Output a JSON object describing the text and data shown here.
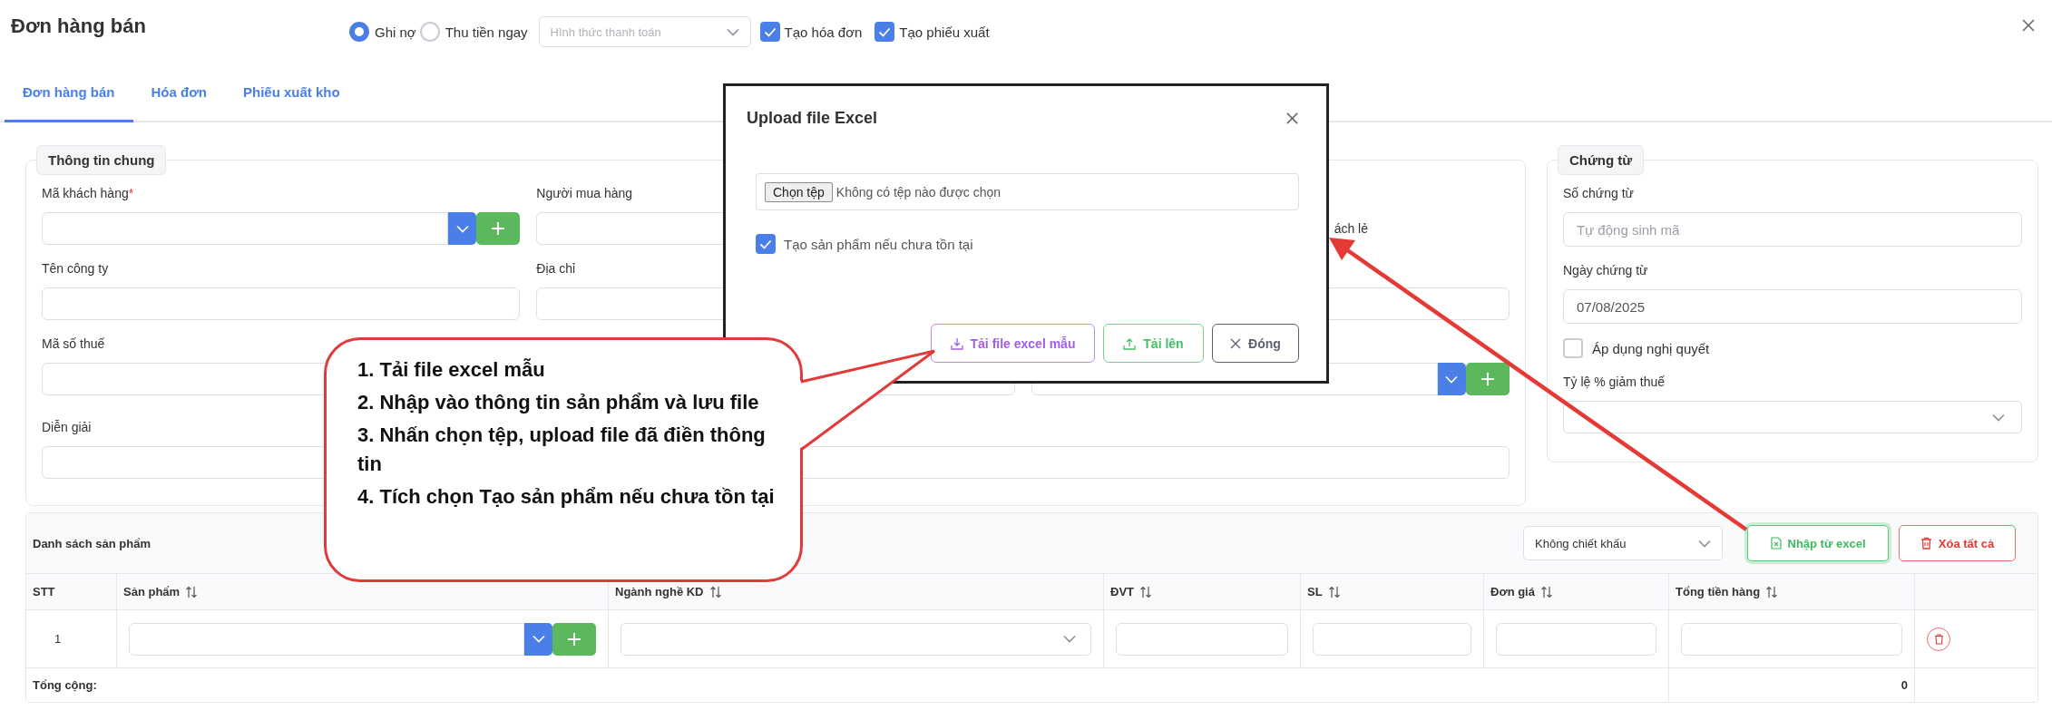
{
  "header": {
    "title": "Đơn hàng bán",
    "payment_types": [
      {
        "label": "Ghi nợ",
        "selected": true
      },
      {
        "label": "Thu tiền ngay",
        "selected": false
      }
    ],
    "payment_method": {
      "placeholder": "Hình thức thanh toán"
    },
    "options": [
      {
        "label": "Tạo hóa đơn",
        "checked": true
      },
      {
        "label": "Tạo phiếu xuất",
        "checked": true
      }
    ]
  },
  "tabs": [
    {
      "label": "Đơn hàng bán",
      "selected": true
    },
    {
      "label": "Hóa đơn",
      "selected": false
    },
    {
      "label": "Phiếu xuất kho",
      "selected": false
    }
  ],
  "general_info": {
    "legend": "Thông tin chung",
    "fields": [
      {
        "kind": "lookup",
        "label": "Mã khách hàng",
        "required_mark": "*"
      },
      {
        "kind": "text",
        "label": "Người mua hàng"
      },
      {
        "kind": "note",
        "text": "ách lẻ"
      },
      {
        "kind": "text",
        "label": "Tên công ty"
      },
      {
        "kind": "text",
        "label": "Địa chỉ"
      },
      {
        "kind": "text"
      },
      {
        "kind": "text",
        "label": "Mã số thuế"
      },
      {
        "kind": "text"
      },
      {
        "kind": "lookup"
      },
      {
        "kind": "wide",
        "label": "Diễn giải"
      }
    ]
  },
  "documents": {
    "legend": "Chứng từ",
    "fields": [
      {
        "kind": "text",
        "label": "Số chứng từ",
        "placeholder": "Tự động sinh mã"
      },
      {
        "kind": "text",
        "label": "Ngày chứng từ",
        "value": "07/08/2025"
      },
      {
        "kind": "checkbox",
        "label": "Áp dụng nghị quyết",
        "checked": false
      },
      {
        "kind": "select",
        "label": "Tỷ lệ % giảm thuế"
      }
    ]
  },
  "products": {
    "title": "Danh sách sản phẩm",
    "discount": {
      "value": "Không chiết khấu"
    },
    "buttons": [
      {
        "kind": "import",
        "label": "Nhập từ excel"
      },
      {
        "kind": "clear",
        "label": "Xóa tất cả"
      }
    ],
    "columns": [
      {
        "label": "STT",
        "sortable": false
      },
      {
        "label": "Sản phẩm",
        "sortable": true
      },
      {
        "label": "Ngành nghề KD",
        "sortable": true
      },
      {
        "label": "ĐVT",
        "sortable": true
      },
      {
        "label": "SL",
        "sortable": true
      },
      {
        "label": "Đơn giá",
        "sortable": true
      },
      {
        "label": "Tổng tiền hàng",
        "sortable": true
      }
    ],
    "rows": [
      {
        "stt": "1",
        "cells": [
          {
            "kind": "lookup"
          },
          {
            "kind": "select"
          },
          {
            "kind": "input"
          },
          {
            "kind": "input"
          },
          {
            "kind": "input"
          },
          {
            "kind": "input"
          },
          {
            "kind": "delete"
          }
        ]
      }
    ],
    "footer": {
      "label": "Tổng cộng:",
      "total": "0"
    }
  },
  "dialog": {
    "title": "Upload file Excel",
    "file_button": "Chọn tệp",
    "file_status": "Không có tệp nào được chọn",
    "create_missing": {
      "label": "Tạo sản phẩm nếu chưa tồn tại",
      "checked": true
    },
    "buttons": [
      {
        "kind": "download",
        "label": "Tải file excel mẫu"
      },
      {
        "kind": "upload",
        "label": "Tải lên"
      },
      {
        "kind": "close",
        "label": "Đóng"
      }
    ]
  },
  "callout": {
    "steps": [
      "1. Tải file excel mẫu",
      "2. Nhập vào thông tin sản phẩm và lưu file",
      "3. Nhấn chọn tệp, upload file đã điền thông tin",
      "4. Tích chọn Tạo sản phẩm nếu chưa tồn tại"
    ]
  }
}
